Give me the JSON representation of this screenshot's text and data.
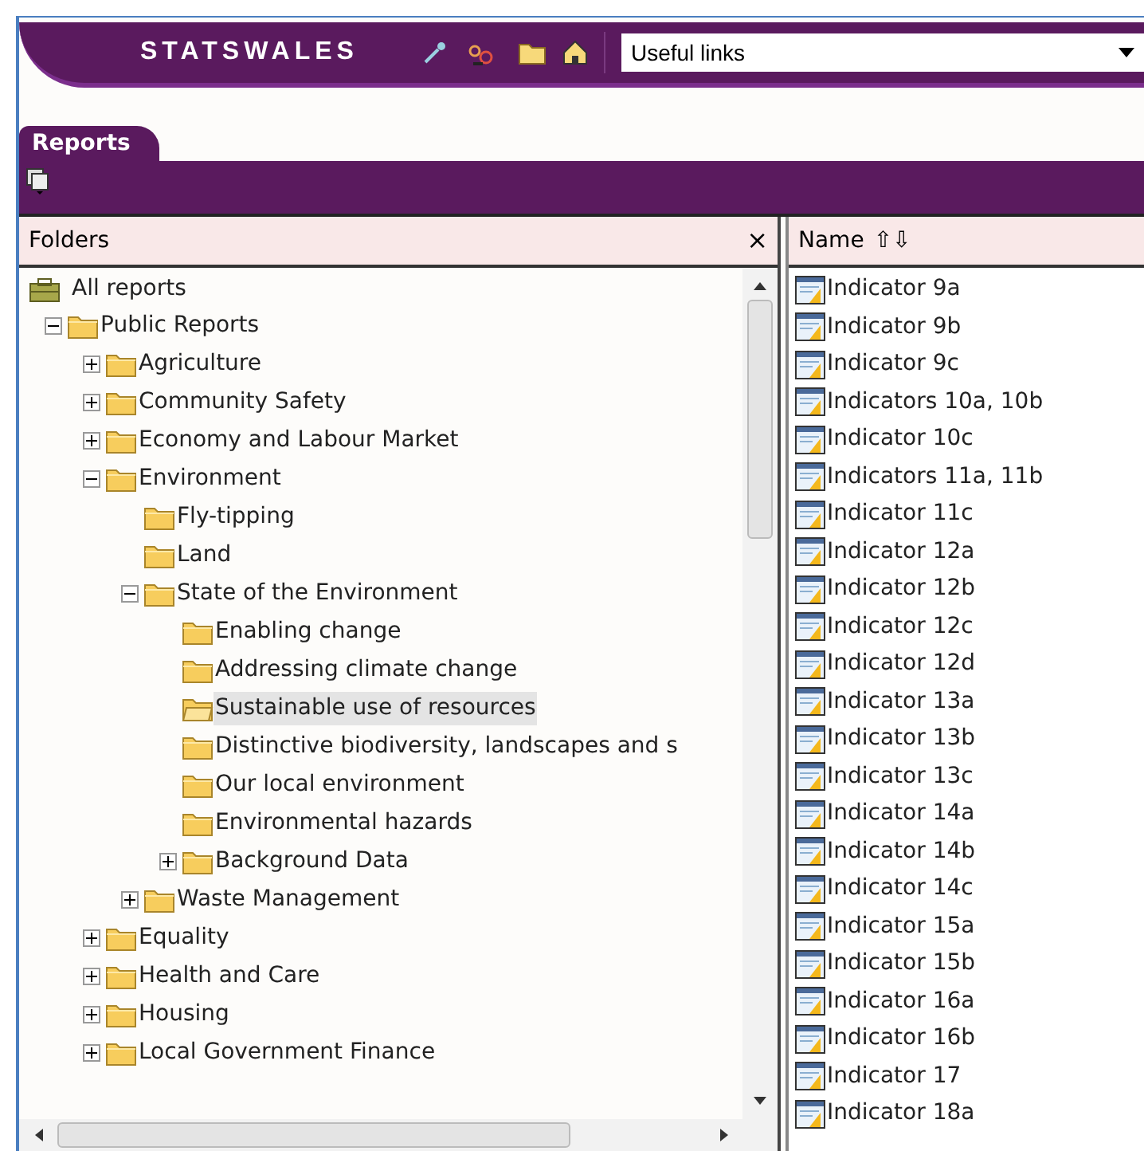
{
  "header": {
    "logo": "STATSWALES",
    "links_select": {
      "value": "Useful links"
    }
  },
  "tabs": [
    {
      "label": "Reports",
      "selected": true
    }
  ],
  "folders_pane": {
    "title": "Folders",
    "close": "×",
    "tree": [
      {
        "label": "All reports",
        "kind": "root",
        "selected": false,
        "children": [
          {
            "label": "Public Reports",
            "kind": "folder",
            "expanded": true,
            "selected": false,
            "children": [
              {
                "label": "Agriculture",
                "kind": "folder",
                "expanded": false,
                "selected": false
              },
              {
                "label": "Community Safety",
                "kind": "folder",
                "expanded": false,
                "selected": false
              },
              {
                "label": "Economy and Labour Market",
                "kind": "folder",
                "expanded": false,
                "selected": false
              },
              {
                "label": "Environment",
                "kind": "folder",
                "expanded": true,
                "selected": false,
                "children": [
                  {
                    "label": "Fly-tipping",
                    "kind": "folder",
                    "selected": false
                  },
                  {
                    "label": "Land",
                    "kind": "folder",
                    "selected": false
                  },
                  {
                    "label": "State of the Environment",
                    "kind": "folder",
                    "expanded": true,
                    "selected": false,
                    "children": [
                      {
                        "label": "Enabling change",
                        "kind": "folder",
                        "selected": false
                      },
                      {
                        "label": "Addressing climate change",
                        "kind": "folder",
                        "selected": false
                      },
                      {
                        "label": "Sustainable use of resources",
                        "kind": "folder",
                        "selected": true
                      },
                      {
                        "label": "Distinctive biodiversity, landscapes and s",
                        "kind": "folder",
                        "selected": false
                      },
                      {
                        "label": "Our local environment",
                        "kind": "folder",
                        "selected": false
                      },
                      {
                        "label": "Environmental hazards",
                        "kind": "folder",
                        "selected": false
                      },
                      {
                        "label": "Background Data",
                        "kind": "folder",
                        "expanded": false,
                        "selected": false
                      }
                    ]
                  },
                  {
                    "label": "Waste Management",
                    "kind": "folder",
                    "expanded": false,
                    "selected": false
                  }
                ]
              },
              {
                "label": "Equality",
                "kind": "folder",
                "expanded": false,
                "selected": false
              },
              {
                "label": "Health and Care",
                "kind": "folder",
                "expanded": false,
                "selected": false
              },
              {
                "label": "Housing",
                "kind": "folder",
                "expanded": false,
                "selected": false
              },
              {
                "label": "Local Government Finance",
                "kind": "folder",
                "expanded": false,
                "selected": false
              }
            ]
          }
        ]
      }
    ]
  },
  "reports_pane": {
    "column": "Name",
    "sort": "⇧⇩",
    "items": [
      "Indicator 9a",
      "Indicator 9b",
      "Indicator 9c",
      "Indicators 10a, 10b",
      "Indicator 10c",
      "Indicators 11a, 11b",
      "Indicator 11c",
      "Indicator 12a",
      "Indicator 12b",
      "Indicator 12c",
      "Indicator 12d",
      "Indicator 13a",
      "Indicator 13b",
      "Indicator 13c",
      "Indicator 14a",
      "Indicator 14b",
      "Indicator 14c",
      "Indicator 15a",
      "Indicator 15b",
      "Indicator 16a",
      "Indicator 16b",
      "Indicator 17",
      "Indicator 18a"
    ]
  }
}
